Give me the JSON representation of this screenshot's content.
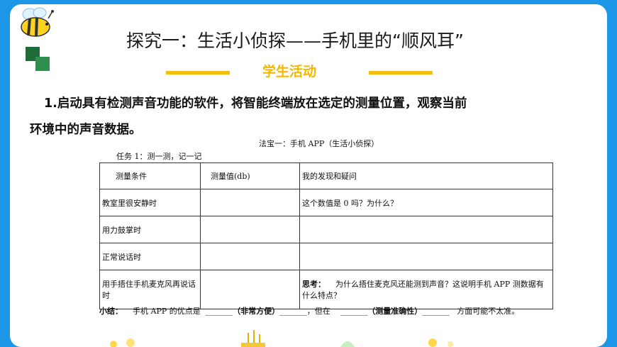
{
  "title": "探究一：生活小侦探——手机里的“顺风耳”",
  "subtitle": "学生活动",
  "intro": {
    "line1": "1.启动具有检测声音功能的软件，将智能终端放在选定的测量位置，观察当前",
    "line2": "环境中的声音数据。"
  },
  "worksheet": {
    "fabao": "法宝一：手机 APP（生活小侦探）",
    "task": "任务 1：测一测，记一记",
    "headers": [
      "测量条件",
      "测量值(db)",
      "我的发现和疑问"
    ],
    "rows": [
      {
        "condition": "教室里很安静时",
        "value": "",
        "note": "这个数值是 0 吗？为什么？"
      },
      {
        "condition": "用力鼓掌时",
        "value": "",
        "note": ""
      },
      {
        "condition": "正常说话时",
        "value": "",
        "note": ""
      },
      {
        "condition": "用手捂住手机麦克风再说话时",
        "value": "",
        "note_label": "思考：",
        "note": "为什么捂住麦克风还能测到声音？这说明手机 APP 测数据有什么特点？"
      }
    ],
    "summary": {
      "label": "小结：",
      "part1": "手机 APP 的优点是",
      "blank1": "_______",
      "hint1": "（非常方便）",
      "blank2": "_______",
      "part2": "，但在",
      "blank3": "_______",
      "hint2": "（测量准确性）",
      "blank4": "_______",
      "part3": "方面可能不太准。"
    }
  },
  "colors": {
    "frame": "#1e96e8",
    "accent": "#f5bf0f",
    "accent_text": "#f5b800",
    "square_dark": "#1f6b3a",
    "square_light": "#2f8f4e"
  }
}
